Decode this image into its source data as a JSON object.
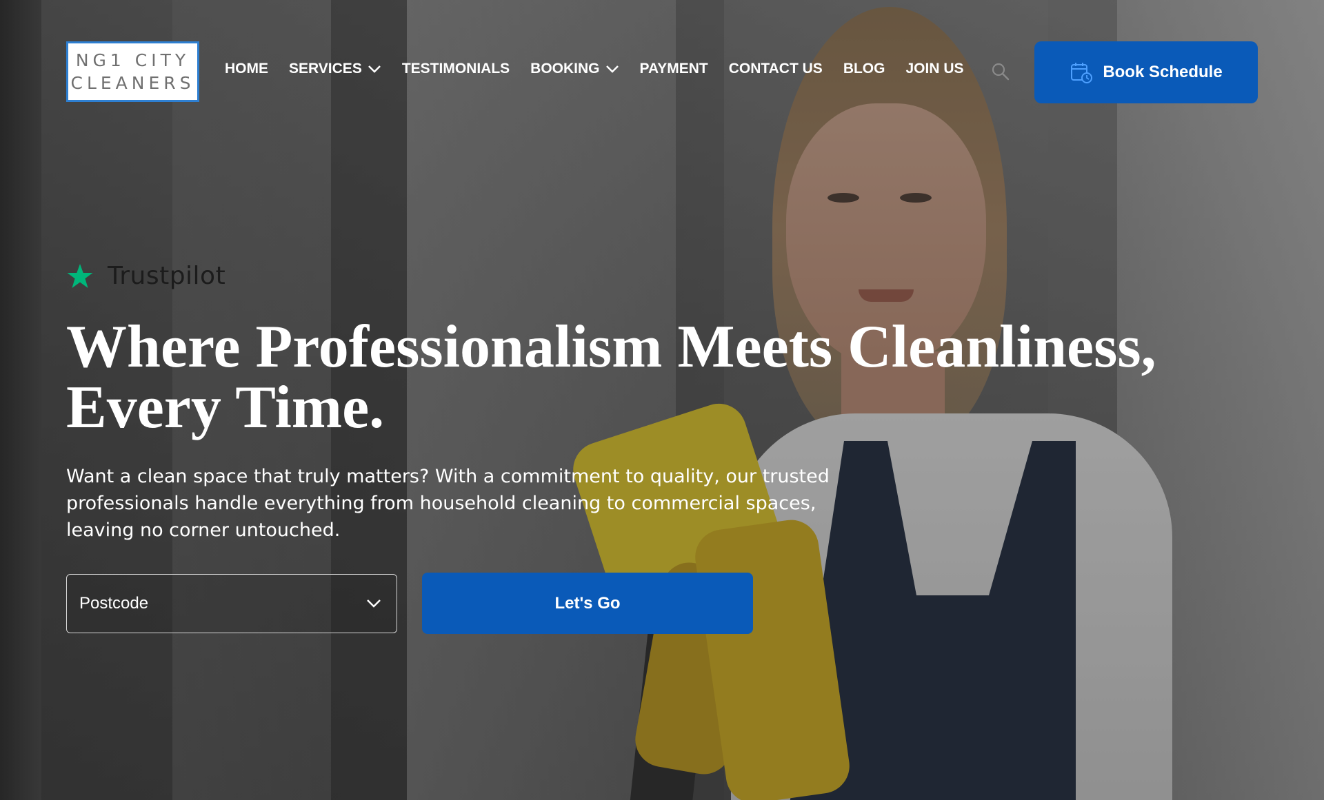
{
  "brand": {
    "logo_line1": "NG1 CITY",
    "logo_line2": "CLEANERS",
    "accent_color": "#0a5ab8",
    "logo_border_color": "#2e7fd1"
  },
  "nav": {
    "items": [
      {
        "label": "HOME",
        "has_dropdown": false
      },
      {
        "label": "SERVICES",
        "has_dropdown": true
      },
      {
        "label": "TESTIMONIALS",
        "has_dropdown": false
      },
      {
        "label": "BOOKING",
        "has_dropdown": true
      },
      {
        "label": "PAYMENT",
        "has_dropdown": false
      },
      {
        "label": "CONTACT US",
        "has_dropdown": false
      },
      {
        "label": "BLOG",
        "has_dropdown": false
      },
      {
        "label": "JOIN US",
        "has_dropdown": false
      }
    ],
    "search_icon": "search-icon",
    "book_button_label": "Book Schedule",
    "book_button_icon": "calendar-clock-icon"
  },
  "hero": {
    "trustpilot_label": "Trustpilot",
    "trustpilot_star_color": "#00b67a",
    "headline_line1": "Where Professionalism Meets Cleanliness,",
    "headline_line2": "Every Time.",
    "subtext": "Want a clean space that truly matters? With a commitment to quality, our trusted professionals handle everything from household cleaning to commercial spaces, leaving no corner untouched.",
    "postcode_placeholder": "Postcode",
    "go_button_label": "Let's Go"
  }
}
